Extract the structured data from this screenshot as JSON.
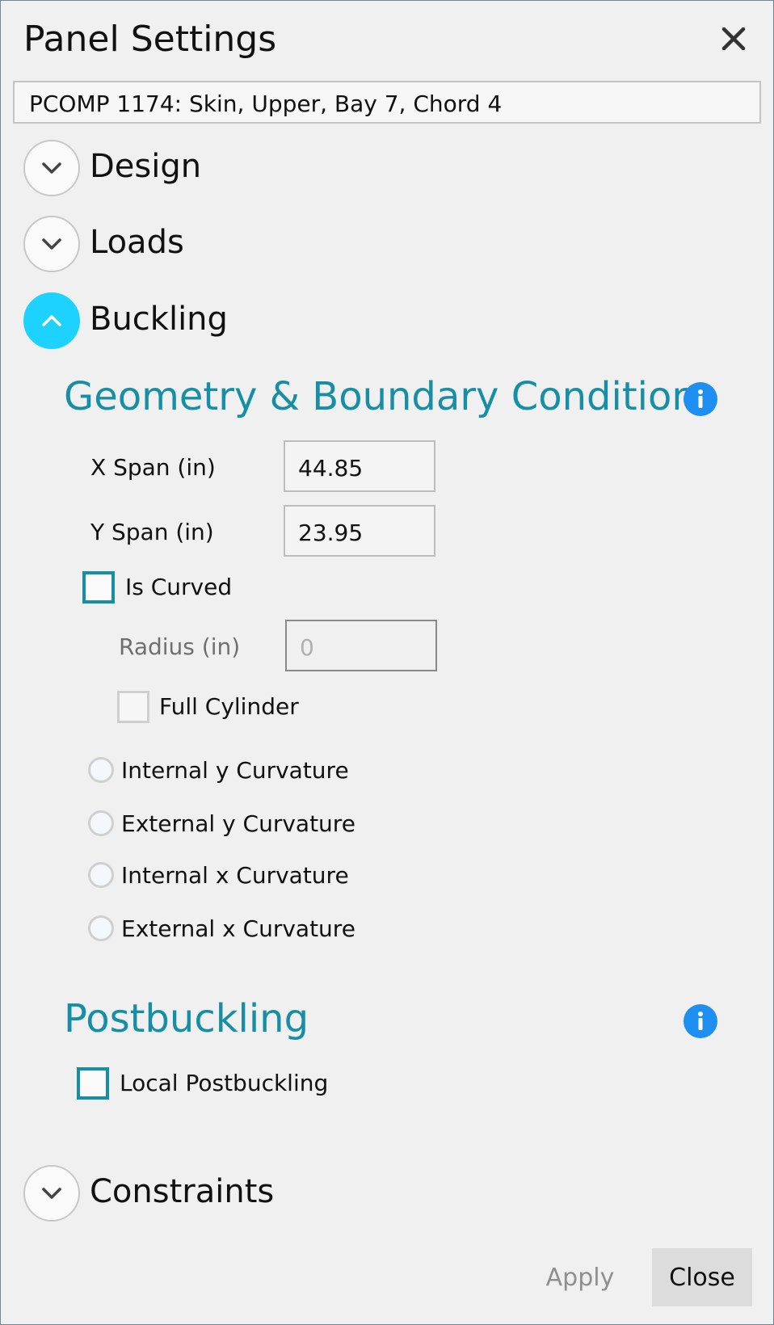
{
  "dialog": {
    "title": "Panel Settings",
    "panel_name": "PCOMP 1174: Skin, Upper, Bay 7, Chord 4"
  },
  "sections": {
    "design": "Design",
    "loads": "Loads",
    "buckling": "Buckling",
    "constraints": "Constraints"
  },
  "geometry": {
    "heading": "Geometry & Boundary Conditions",
    "x_span_label": "X Span (in)",
    "x_span_value": "44.85",
    "y_span_label": "Y Span (in)",
    "y_span_value": "23.95",
    "is_curved_label": "Is Curved",
    "is_curved_checked": false,
    "radius_label": "Radius (in)",
    "radius_value": "0",
    "full_cylinder_label": "Full Cylinder",
    "full_cylinder_checked": false,
    "curvature_options": [
      "Internal y Curvature",
      "External y Curvature",
      "Internal x Curvature",
      "External x Curvature"
    ]
  },
  "postbuckling": {
    "heading": "Postbuckling",
    "local_label": "Local Postbuckling",
    "local_checked": false
  },
  "buttons": {
    "apply": "Apply",
    "close": "Close"
  },
  "colors": {
    "accent": "#168fa6",
    "expanded_chevron": "#1ed2ff",
    "info": "#1e8ef0"
  },
  "icons": {
    "close": "close-icon",
    "expand": "chevron-down-icon",
    "collapse": "chevron-up-icon",
    "info": "info-icon"
  }
}
